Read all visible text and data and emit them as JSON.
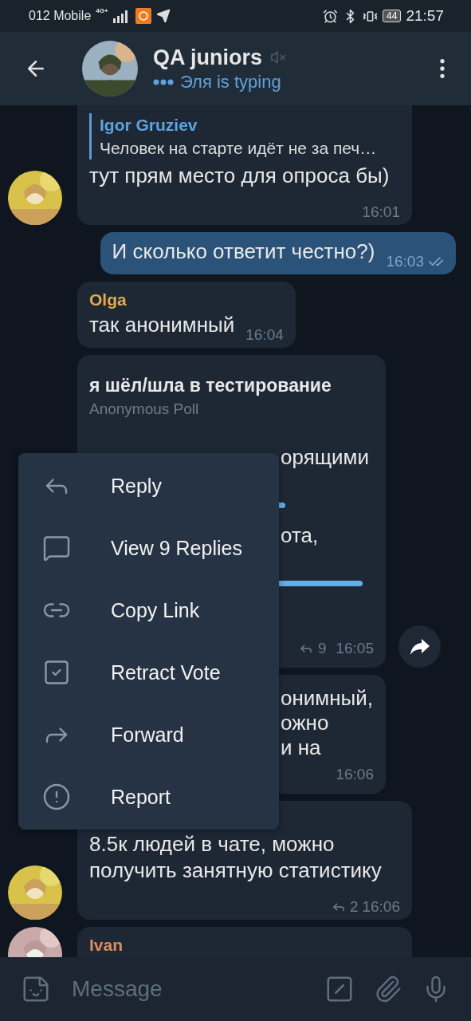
{
  "status_bar": {
    "carrier": "012 Mobile",
    "network": "4G+",
    "battery": "44",
    "time": "21:57"
  },
  "header": {
    "title": "QA juniors",
    "muted": true,
    "subtitle": "Эля is typing"
  },
  "messages": [
    {
      "kind": "text",
      "outgoing": false,
      "avatar": true,
      "quote": {
        "author": "Igor Gruziev",
        "text": "Человек на старте идёт не за печ…"
      },
      "text": "тут прям место для опроса бы)",
      "time": "16:01"
    },
    {
      "kind": "text",
      "outgoing": true,
      "avatar": false,
      "text": "И сколько ответит честно?)",
      "time": "16:03",
      "read": true
    },
    {
      "kind": "text",
      "outgoing": false,
      "avatar": false,
      "sender": {
        "name": "Olga",
        "color": "#e0ab4f"
      },
      "text": "так анонимный",
      "time": "16:04"
    },
    {
      "kind": "poll",
      "outgoing": false,
      "avatar": false,
      "question": "я шёл/шла в тестирование",
      "poll_type": "Anonymous Poll",
      "options": [
        {
          "text": "орящими",
          "level": 0.69
        },
        {
          "text": "ота,",
          "level": 0.96
        }
      ],
      "replies": "9",
      "time": "16:05"
    },
    {
      "kind": "partial",
      "outgoing": false,
      "avatar": false,
      "lines": [
        "онимный,",
        "ожно",
        "и на"
      ],
      "time": "16:06"
    },
    {
      "kind": "text",
      "outgoing": false,
      "avatar": true,
      "text": "8.5к людей в чате, можно получить занятную статистику",
      "replies": "2",
      "time": "16:06"
    },
    {
      "kind": "text",
      "outgoing": false,
      "avatar": true,
      "sender": {
        "name": "Ivan",
        "color": "#d98d5e"
      }
    }
  ],
  "context_menu": [
    {
      "label": "Reply"
    },
    {
      "label": "View 9 Replies"
    },
    {
      "label": "Copy Link"
    },
    {
      "label": "Retract Vote"
    },
    {
      "label": "Forward"
    },
    {
      "label": "Report"
    }
  ],
  "composer": {
    "placeholder": "Message"
  }
}
